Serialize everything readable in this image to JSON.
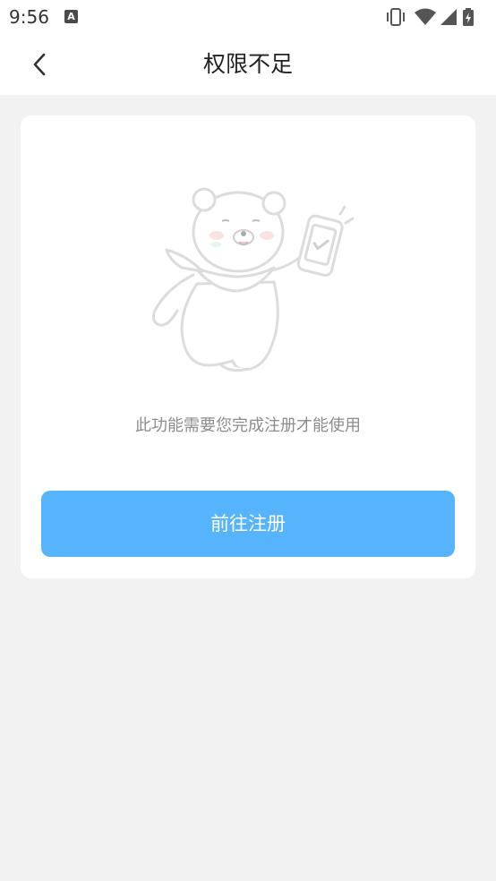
{
  "status_bar": {
    "time": "9:56",
    "app_icon_letter": "A",
    "icons": [
      "vibrate-icon",
      "wifi-icon",
      "signal-icon",
      "battery-charging-icon"
    ]
  },
  "nav": {
    "back_icon": "chevron-left-icon",
    "title": "权限不足"
  },
  "card": {
    "illustration": "bear-holding-phone-illustration",
    "message": "此功能需要您完成注册才能使用",
    "button_label": "前往注册"
  },
  "colors": {
    "accent": "#55b4fb",
    "page_background": "#f2f2f2",
    "message_text": "#8c8c8c"
  }
}
